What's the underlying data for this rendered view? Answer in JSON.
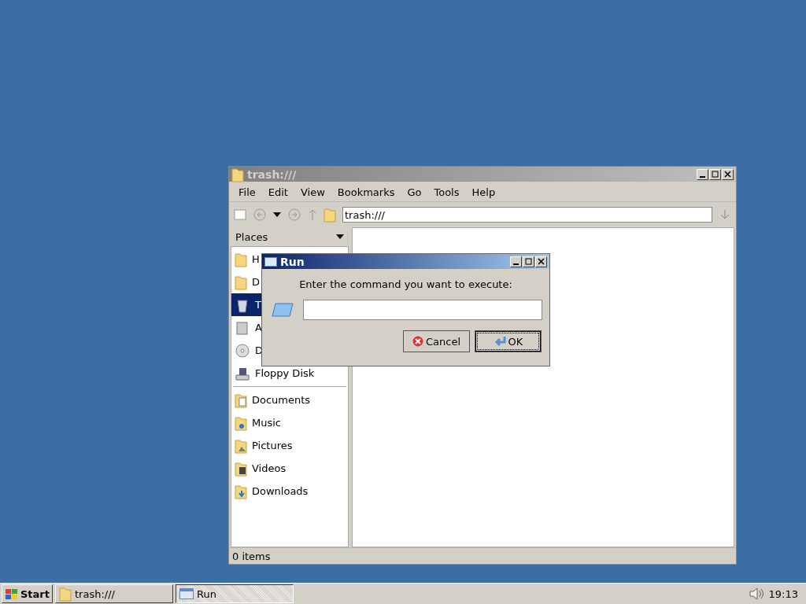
{
  "file_manager": {
    "title": "trash:///",
    "menu": [
      "File",
      "Edit",
      "View",
      "Bookmarks",
      "Go",
      "Tools",
      "Help"
    ],
    "location": "trash:///",
    "places_label": "Places",
    "places": [
      {
        "label": "H",
        "kind": "home",
        "selected": false
      },
      {
        "label": "D",
        "kind": "desktop",
        "selected": false
      },
      {
        "label": "T",
        "kind": "trash",
        "selected": true
      },
      {
        "label": "A",
        "kind": "apps",
        "selected": false
      },
      {
        "label": "D",
        "kind": "disc",
        "selected": false
      },
      {
        "label": "Floppy Disk",
        "kind": "floppy",
        "selected": false
      }
    ],
    "bookmarks": [
      {
        "label": "Documents",
        "kind": "docs",
        "selected": false
      },
      {
        "label": "Music",
        "kind": "music",
        "selected": false
      },
      {
        "label": "Pictures",
        "kind": "pictures",
        "selected": false
      },
      {
        "label": "Videos",
        "kind": "videos",
        "selected": false
      },
      {
        "label": "Downloads",
        "kind": "downloads",
        "selected": false
      }
    ],
    "status": "0 items"
  },
  "run_dialog": {
    "title": "Run",
    "prompt": "Enter the command you want to execute:",
    "buttons": [
      {
        "label": "Cancel",
        "kind": "cancel",
        "focused": false
      },
      {
        "label": "OK",
        "kind": "ok",
        "focused": true
      }
    ]
  },
  "taskbar": {
    "start": "Start",
    "tasks": [
      {
        "label": "trash:///",
        "kind": "folder",
        "selected": false
      },
      {
        "label": "Run",
        "kind": "window",
        "selected": true
      }
    ],
    "clock": "19:13"
  }
}
